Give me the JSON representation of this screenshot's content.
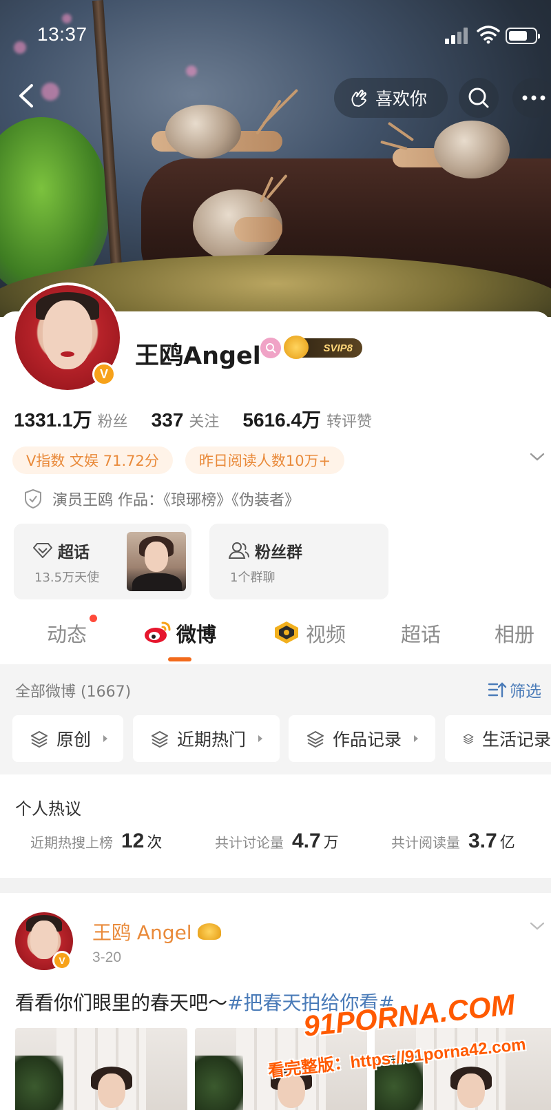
{
  "status_bar": {
    "time": "13:37"
  },
  "header": {
    "like_label": "喜欢你",
    "back_icon": "chevron-left-icon",
    "search_icon": "search-icon",
    "more_icon": "more-icon"
  },
  "profile": {
    "name": "王鸥Angel",
    "vip_badge": "SVIP8",
    "verified_mark": "V",
    "stats": [
      {
        "value": "1331.1万",
        "label": "粉丝"
      },
      {
        "value": "337",
        "label": "关注"
      },
      {
        "value": "5616.4万",
        "label": "转评赞"
      }
    ],
    "tags": [
      "V指数 文娱 71.72分",
      "昨日阅读人数10万+"
    ],
    "bio": "演员王鸥 作品：《琅琊榜》《伪装者》",
    "tiles": [
      {
        "title": "超话",
        "subtitle": "13.5万天使"
      },
      {
        "title": "粉丝群",
        "subtitle": "1个群聊"
      }
    ]
  },
  "tabs": [
    {
      "label": "动态"
    },
    {
      "label": "微博"
    },
    {
      "label": "视频"
    },
    {
      "label": "超话"
    },
    {
      "label": "相册"
    }
  ],
  "feed": {
    "all_label": "全部微博 (1667)",
    "filter_label": "筛选",
    "chips": [
      "原创",
      "近期热门",
      "作品记录",
      "生活记录"
    ]
  },
  "hot": {
    "title": "个人热议",
    "items": [
      {
        "label": "近期热搜上榜",
        "value": "12",
        "unit": "次"
      },
      {
        "label": "共计讨论量",
        "value": "4.7",
        "unit": "万"
      },
      {
        "label": "共计阅读量",
        "value": "3.7",
        "unit": "亿"
      }
    ]
  },
  "post": {
    "author": "王鸥 Angel",
    "date": "3-20",
    "text": "看看你们眼里的春天吧～",
    "topic": "#把春天拍给你看#"
  },
  "watermark": {
    "line1": "91PORNA.COM",
    "line2": "看完整版：https://91porna42.com"
  },
  "colors": {
    "accent_orange": "#f26a1b",
    "tag_text": "#e98a3a",
    "link_blue": "#4a7bb8"
  }
}
